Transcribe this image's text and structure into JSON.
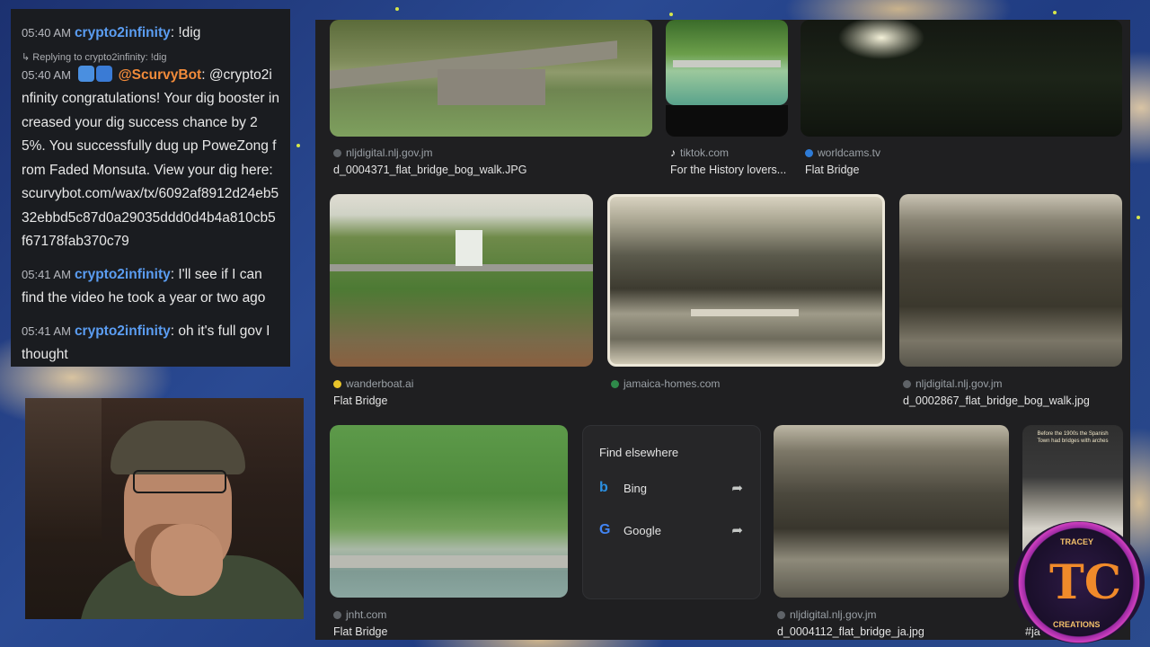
{
  "chat": {
    "messages": [
      {
        "time": "05:40 AM",
        "user": "crypto2infinity",
        "text": ": !dig"
      },
      {
        "reply_to": "Replying to crypto2infinity: !dig",
        "time": "05:40 AM",
        "user": "@ScurvyBot",
        "text": ": @crypto2infinity congratulations! Your dig booster increased your dig success chance by 25%. You successfully dug up PoweZong from Faded Monsuta. View your dig here: scurvybot.com/wax/tx/6092af8912d24eb532ebbd5c87d0a29035ddd0d4b4a810cb5f67178fab370c79"
      },
      {
        "time": "05:41 AM",
        "user": "crypto2infinity",
        "text": ": I'll see if I can find the video he took a year or two ago"
      },
      {
        "time": "05:41 AM",
        "user": "crypto2infinity",
        "text": ": oh it's full gov I thought"
      }
    ]
  },
  "results": {
    "row1": [
      {
        "source": "nljdigital.nlj.gov.jm",
        "title": "d_0004371_flat_bridge_bog_walk.JPG",
        "icon": "globe-icon"
      },
      {
        "source": "tiktok.com",
        "title": "For the History lovers...",
        "icon": "tiktok-icon"
      },
      {
        "source": "worldcams.tv",
        "title": "Flat Bridge",
        "icon": "worldcams-icon"
      }
    ],
    "row2": [
      {
        "source": "wanderboat.ai",
        "title": "Flat Bridge",
        "icon": "wanderboat-icon"
      },
      {
        "source": "jamaica-homes.com",
        "title": "",
        "icon": "jamaica-homes-icon"
      },
      {
        "source": "nljdigital.nlj.gov.jm",
        "title": "d_0002867_flat_bridge_bog_walk.jpg",
        "icon": "globe-icon"
      }
    ],
    "row3": [
      {
        "source": "jnht.com",
        "title": "Flat Bridge",
        "icon": "globe-icon"
      },
      {
        "source": "nljdigital.nlj.gov.jm",
        "title": "d_0004112_flat_bridge_ja.jpg",
        "icon": "globe-icon"
      },
      {
        "source": "",
        "title": "#ja",
        "icon": ""
      }
    ],
    "find_elsewhere": {
      "heading": "Find elsewhere",
      "engines": [
        {
          "name": "Bing",
          "logo": "b"
        },
        {
          "name": "Google",
          "logo": "G"
        }
      ]
    },
    "poster_caption": "Before the 1900s the Spanish Town had bridges with arches"
  },
  "logo": {
    "top_text": "TRACEY",
    "bottom_text": "CREATIONS",
    "mark": "TC"
  }
}
